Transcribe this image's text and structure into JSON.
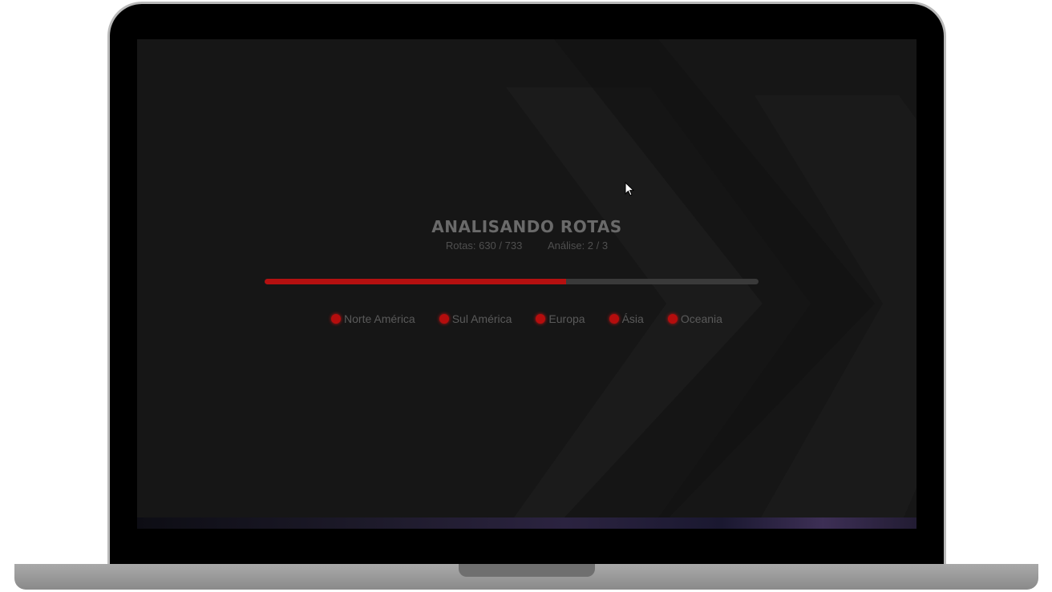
{
  "screen": {
    "title": "ANALISANDO ROTAS",
    "routes_label": "Rotas: 630 / 733",
    "analysis_label": "Análise: 2 / 3",
    "progress": 0.61,
    "regions": [
      {
        "label": "Norte América"
      },
      {
        "label": "Sul América"
      },
      {
        "label": "Europa"
      },
      {
        "label": "Ásia"
      },
      {
        "label": "Oceania"
      }
    ]
  },
  "colors": {
    "accent": "#b51010",
    "background": "#161616"
  }
}
